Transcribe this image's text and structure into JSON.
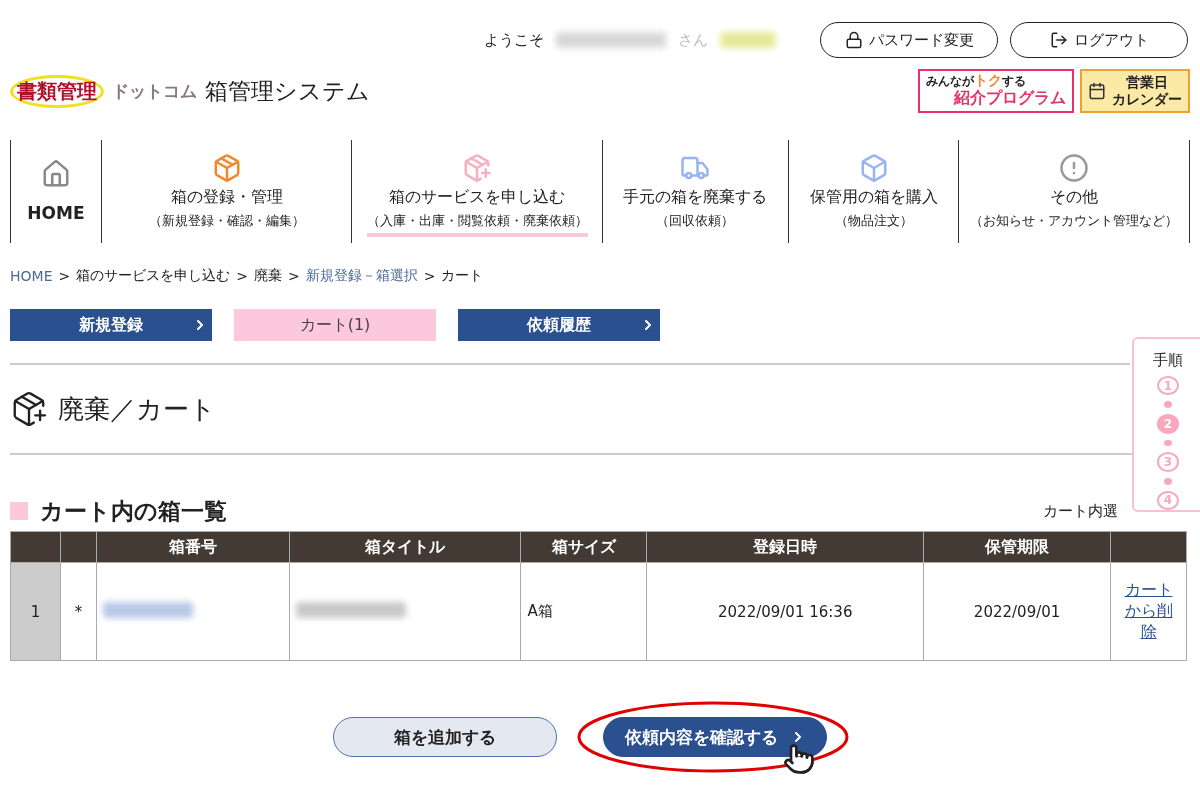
{
  "header": {
    "welcome": "ようこそ",
    "user_suffix": "さん",
    "buttons": [
      {
        "kind": "lock",
        "label": "パスワード変更"
      },
      {
        "kind": "logout",
        "label": "ログアウト"
      }
    ]
  },
  "logo": {
    "brand": "書類管理",
    "brand_sub": "ドットコム",
    "system": "箱管理システム"
  },
  "promo": {
    "lead": "みんなが",
    "accent": "トク",
    "tail": "する",
    "title": "紹介プログラム"
  },
  "calendar": {
    "line_1": "営業日",
    "line_2": "カレンダー"
  },
  "nav": [
    {
      "kind": "home",
      "title": "HOME",
      "selected": false
    },
    {
      "kind": "box",
      "title": "箱の登録・管理",
      "sub": "（新規登録・確認・編集）",
      "selected": false
    },
    {
      "kind": "service",
      "title": "箱のサービスを申し込む",
      "sub": "（入庫・出庫・閲覧依頼・廃棄依頼）",
      "selected": true
    },
    {
      "kind": "truck",
      "title": "手元の箱を廃棄する",
      "sub": "（回収依頼）",
      "selected": false
    },
    {
      "kind": "buy",
      "title": "保管用の箱を購入",
      "sub": "（物品注文）",
      "selected": false
    },
    {
      "kind": "other",
      "title": "その他",
      "sub": "（お知らせ・アカウント管理など）",
      "selected": false
    }
  ],
  "breadcrumb": [
    {
      "text": "HOME",
      "link": true
    },
    {
      "separator": ">",
      "text": "箱のサービスを申し込む",
      "link": false
    },
    {
      "separator": ">",
      "text": "廃棄",
      "link": false
    },
    {
      "separator": ">",
      "text": "新規登録－箱選択",
      "link": true
    },
    {
      "separator": ">",
      "text": "カート",
      "link": false
    }
  ],
  "tabs": [
    {
      "label": "新規登録",
      "selected": false
    },
    {
      "label": "カート(1)",
      "selected": true
    },
    {
      "label": "依頼履歴",
      "selected": false
    }
  ],
  "page_title": "廃棄／カート",
  "section": {
    "title": "カート内の箱一覧",
    "note": "カート内選"
  },
  "table": {
    "columns": [
      "箱番号",
      "箱タイトル",
      "箱サイズ",
      "登録日時",
      "保管期限"
    ],
    "rows": [
      {
        "index": "1",
        "mark": "*",
        "size": "A箱",
        "registered": "2022/09/01 16:36",
        "expires": "2022/09/01",
        "action": "カートから削除"
      }
    ]
  },
  "actions": [
    {
      "kind": "secondary",
      "label": "箱を追加する"
    },
    {
      "kind": "primary",
      "label": "依頼内容を確認する",
      "highlighted": true
    }
  ],
  "steps": {
    "title": "手順",
    "items": [
      {
        "label": "1",
        "selected": false
      },
      {
        "label": "2",
        "selected": true
      },
      {
        "label": "3",
        "selected": false
      },
      {
        "label": "4",
        "selected": false
      }
    ]
  }
}
